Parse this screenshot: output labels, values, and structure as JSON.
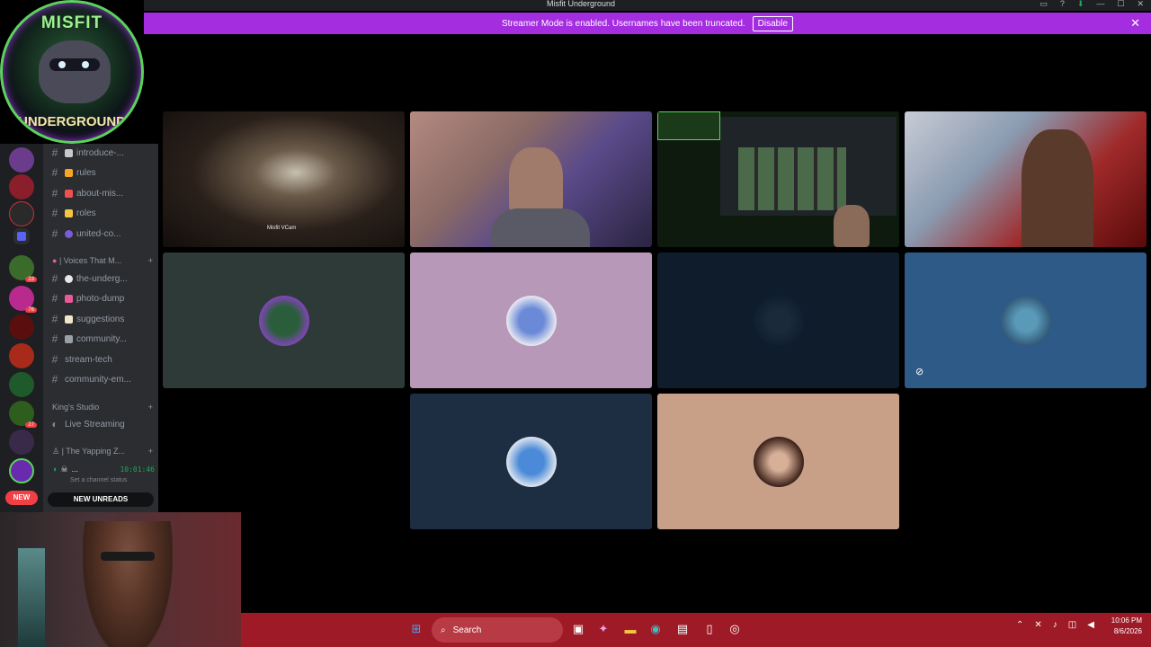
{
  "window": {
    "title": "Misfit Underground",
    "controls": [
      "▭",
      "?",
      "⬇",
      "—",
      "☐",
      "✕"
    ]
  },
  "banner": {
    "text": "Streamer Mode is enabled. Usernames have been truncated.",
    "disable_label": "Disable",
    "close_icon": "✕"
  },
  "logo": {
    "line1": "MISFIT",
    "line2": "UNDERGROUND"
  },
  "guilds": {
    "badges": [
      "23",
      "76",
      "27"
    ],
    "new_pill": "NEW"
  },
  "channels": [
    {
      "label": "introduce-...",
      "emoji_color": "#c9c9c9"
    },
    {
      "label": "rules",
      "emoji_color": "#f5a623"
    },
    {
      "label": "about-mis...",
      "emoji_color": "#f05050"
    },
    {
      "label": "roles",
      "emoji_color": "#f5c542"
    },
    {
      "label": "united-co...",
      "emoji_color": "#7a5cd6"
    }
  ],
  "category_voices": "| Voices That M...",
  "channels2": [
    {
      "label": "the-underg...",
      "emoji_color": "#e8e8e8"
    },
    {
      "label": "photo-dump",
      "emoji_color": "#e85a9a"
    },
    {
      "label": "suggestions",
      "emoji_color": "#f0e6c8"
    },
    {
      "label": "community...",
      "emoji_color": "#9aa0a8"
    },
    {
      "label": "stream-tech",
      "emoji_color": ""
    },
    {
      "label": "community-em...",
      "emoji_color": ""
    }
  ],
  "category_kings": "King's Studio",
  "live_streaming": "Live Streaming",
  "category_yapping": "| The Yapping Z...",
  "voice_user": {
    "name": "...",
    "timer": "10:01:46"
  },
  "status_hint": "Set a channel status",
  "new_unreads": "NEW UNREADS",
  "tiles": {
    "t1_tag": "Misfit VCam"
  },
  "taskbar": {
    "search_label": "Search",
    "time": "10:06 PM",
    "date": "8/6/2026"
  }
}
